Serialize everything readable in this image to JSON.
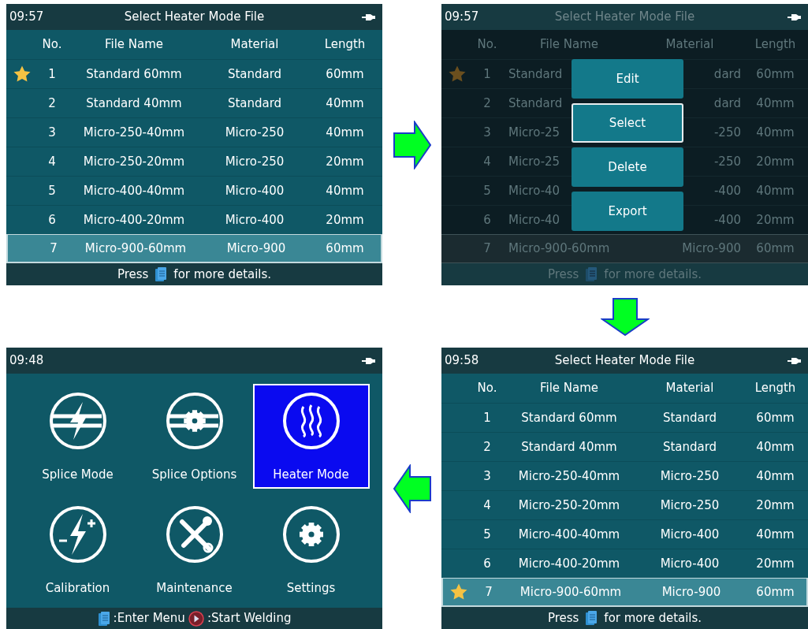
{
  "screens": [
    {
      "kind": "file_list",
      "dimmed": false,
      "time": "09:57",
      "title": "Select Heater Mode File",
      "columns": [
        "No.",
        "File Name",
        "Material",
        "Length"
      ],
      "rows": [
        {
          "no": "1",
          "file_name": "Standard 60mm",
          "material": "Standard",
          "length": "60mm",
          "starred": true,
          "selected": false
        },
        {
          "no": "2",
          "file_name": "Standard 40mm",
          "material": "Standard",
          "length": "40mm",
          "starred": false,
          "selected": false
        },
        {
          "no": "3",
          "file_name": "Micro-250-40mm",
          "material": "Micro-250",
          "length": "40mm",
          "starred": false,
          "selected": false
        },
        {
          "no": "4",
          "file_name": "Micro-250-20mm",
          "material": "Micro-250",
          "length": "20mm",
          "starred": false,
          "selected": false
        },
        {
          "no": "5",
          "file_name": "Micro-400-40mm",
          "material": "Micro-400",
          "length": "40mm",
          "starred": false,
          "selected": false
        },
        {
          "no": "6",
          "file_name": "Micro-400-20mm",
          "material": "Micro-400",
          "length": "20mm",
          "starred": false,
          "selected": false
        },
        {
          "no": "7",
          "file_name": "Micro-900-60mm",
          "material": "Micro-900",
          "length": "60mm",
          "starred": false,
          "selected": true
        }
      ],
      "footer": {
        "before": "Press",
        "after": "for more details."
      }
    },
    {
      "kind": "file_list",
      "dimmed": true,
      "time": "09:57",
      "title": "Select Heater Mode File",
      "columns": [
        "No.",
        "File Name",
        "Material",
        "Length"
      ],
      "rows": [
        {
          "no": "1",
          "file_name": "Standard",
          "material": "dard",
          "length": "60mm",
          "starred": true,
          "selected": false
        },
        {
          "no": "2",
          "file_name": "Standard",
          "material": "dard",
          "length": "40mm",
          "starred": false,
          "selected": false
        },
        {
          "no": "3",
          "file_name": "Micro-25",
          "material": "-250",
          "length": "40mm",
          "starred": false,
          "selected": false
        },
        {
          "no": "4",
          "file_name": "Micro-25",
          "material": "-250",
          "length": "20mm",
          "starred": false,
          "selected": false
        },
        {
          "no": "5",
          "file_name": "Micro-40",
          "material": "-400",
          "length": "40mm",
          "starred": false,
          "selected": false
        },
        {
          "no": "6",
          "file_name": "Micro-40",
          "material": "-400",
          "length": "20mm",
          "starred": false,
          "selected": false
        },
        {
          "no": "7",
          "file_name": "Micro-900-60mm",
          "material": "Micro-900",
          "length": "60mm",
          "starred": false,
          "selected": true
        }
      ],
      "popup_menu": [
        {
          "label": "Edit",
          "selected": false
        },
        {
          "label": "Select",
          "selected": true
        },
        {
          "label": "Delete",
          "selected": false
        },
        {
          "label": "Export",
          "selected": false
        }
      ],
      "footer": {
        "before": "Press",
        "after": "for more details."
      }
    },
    {
      "kind": "main_menu",
      "time": "09:48",
      "items": [
        {
          "label": "Splice Mode",
          "selected": false
        },
        {
          "label": "Splice Options",
          "selected": false
        },
        {
          "label": "Heater Mode",
          "selected": true
        },
        {
          "label": "Calibration",
          "selected": false
        },
        {
          "label": "Maintenance",
          "selected": false
        },
        {
          "label": "Settings",
          "selected": false
        }
      ],
      "footer": [
        ":Enter Menu",
        ":Start Welding"
      ]
    },
    {
      "kind": "file_list",
      "dimmed": false,
      "time": "09:58",
      "title": "Select Heater Mode File",
      "columns": [
        "No.",
        "File Name",
        "Material",
        "Length"
      ],
      "rows": [
        {
          "no": "1",
          "file_name": "Standard 60mm",
          "material": "Standard",
          "length": "60mm",
          "starred": false,
          "selected": false
        },
        {
          "no": "2",
          "file_name": "Standard 40mm",
          "material": "Standard",
          "length": "40mm",
          "starred": false,
          "selected": false
        },
        {
          "no": "3",
          "file_name": "Micro-250-40mm",
          "material": "Micro-250",
          "length": "40mm",
          "starred": false,
          "selected": false
        },
        {
          "no": "4",
          "file_name": "Micro-250-20mm",
          "material": "Micro-250",
          "length": "20mm",
          "starred": false,
          "selected": false
        },
        {
          "no": "5",
          "file_name": "Micro-400-40mm",
          "material": "Micro-400",
          "length": "40mm",
          "starred": false,
          "selected": false
        },
        {
          "no": "6",
          "file_name": "Micro-400-20mm",
          "material": "Micro-400",
          "length": "20mm",
          "starred": false,
          "selected": false
        },
        {
          "no": "7",
          "file_name": "Micro-900-60mm",
          "material": "Micro-900",
          "length": "60mm",
          "starred": true,
          "selected": true
        }
      ],
      "footer": {
        "before": "Press",
        "after": "for more details."
      }
    }
  ],
  "arrows": [
    {
      "kind": "right"
    },
    {
      "kind": "down"
    },
    {
      "kind": "left"
    }
  ]
}
